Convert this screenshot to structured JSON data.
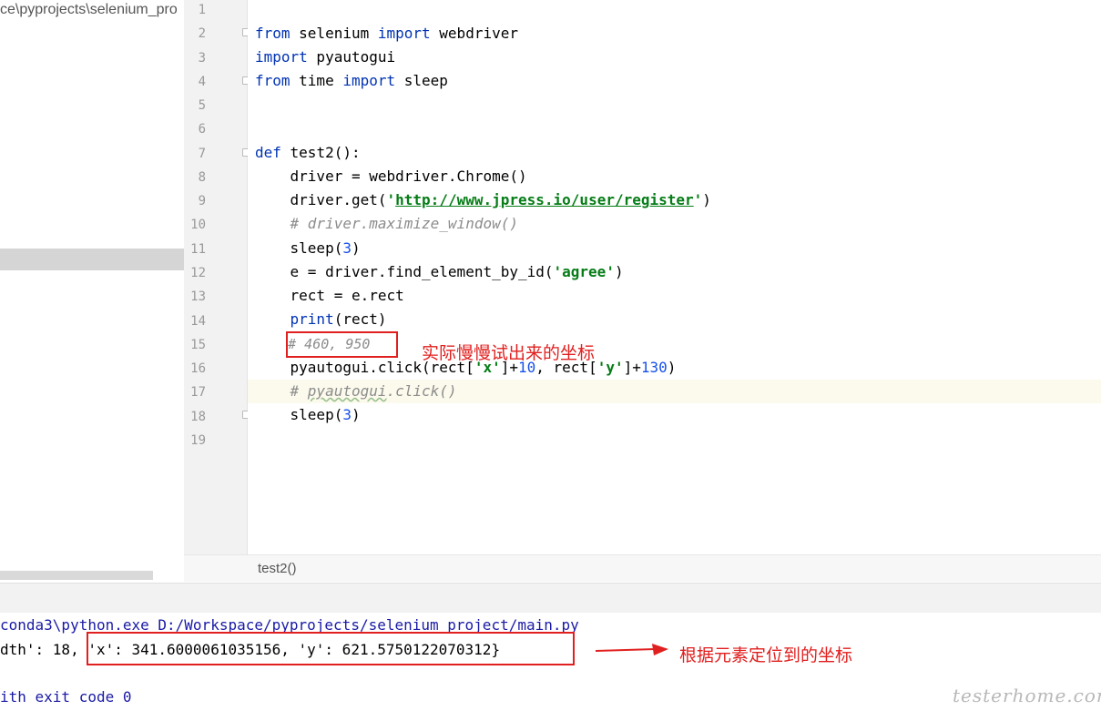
{
  "project": {
    "path": "ce\\pyprojects\\selenium_pro"
  },
  "editor": {
    "line_numbers": [
      "1",
      "2",
      "3",
      "4",
      "5",
      "6",
      "7",
      "8",
      "9",
      "10",
      "11",
      "12",
      "13",
      "14",
      "15",
      "16",
      "17",
      "18",
      "19"
    ],
    "l2": {
      "a": "from",
      "b": " selenium ",
      "c": "import",
      "d": " webdriver"
    },
    "l3": {
      "a": "import",
      "b": " pyautogui"
    },
    "l4": {
      "a": "from",
      "b": " time ",
      "c": "import",
      "d": " sleep"
    },
    "l7": {
      "a": "def",
      "b": " test2():"
    },
    "l8": {
      "a": "    driver = webdriver.Chrome()"
    },
    "l9": {
      "a": "    driver.get(",
      "b": "'",
      "c": "http://www.jpress.io/user/register",
      "d": "'",
      "e": ")"
    },
    "l10": {
      "a": "    # driver.maximize_window()"
    },
    "l11": {
      "a": "    sleep(",
      "b": "3",
      "c": ")"
    },
    "l12": {
      "a": "    e = driver.find_element_by_id(",
      "b": "'agree'",
      "c": ")"
    },
    "l13": {
      "a": "    rect = e.rect"
    },
    "l14": {
      "a": "    ",
      "b": "print",
      "c": "(rect)"
    },
    "l15": {
      "a": "    # 460, 950"
    },
    "l16": {
      "a": "    pyautogui.click(rect[",
      "b": "'x'",
      "c": "]+",
      "d": "10",
      "e": ", rect[",
      "f": "'y'",
      "g": "]+",
      "h": "130",
      "i": ")"
    },
    "l17": {
      "a": "    # ",
      "b": "pyautogui",
      "c": ".click()"
    },
    "l18": {
      "a": "    sleep(",
      "b": "3",
      "c": ")"
    }
  },
  "breadcrumb": "test2()",
  "console": {
    "line1": "conda3\\python.exe D:/Workspace/pyprojects/selenium_project/main.py",
    "line2": "dth': 18, 'x': 341.6000061035156, 'y': 621.5750122070312}",
    "line4": "ith exit code 0"
  },
  "annotations": {
    "note1": "实际慢慢试出来的坐标",
    "note2": "根据元素定位到的坐标",
    "color": "#e0201f"
  },
  "watermark": "testerhome.com"
}
